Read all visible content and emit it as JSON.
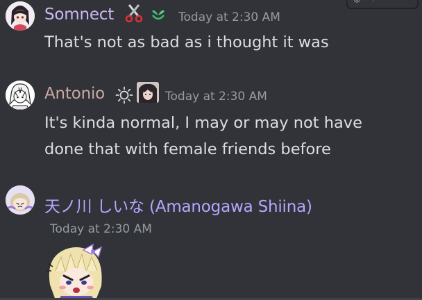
{
  "messages": [
    {
      "author": "Somnect",
      "author_color": "#c9b8f5",
      "timestamp": "Today at 2:30 AM",
      "text_lines": [
        "That's not as bad as i thought it was"
      ],
      "badges": [
        "scissors-icon",
        "sprout-icon"
      ]
    },
    {
      "author": "Antonio",
      "author_color": "#c8a8a4",
      "timestamp": "Today at 2:30 AM",
      "text_lines": [
        "It's kinda normal, I may or may not have",
        "done that with female friends before"
      ],
      "badges": [
        "sun-icon",
        "role-image-icon"
      ]
    },
    {
      "author": "天ノ川 しいな (Amanogawa Shiina)",
      "author_color": "#b4a6ff",
      "timestamp": "Today at 2:30 AM",
      "text_lines": [],
      "sticker": "chibi-sticker",
      "badges": []
    }
  ],
  "colors": {
    "background": "#313338",
    "text": "#dbdee1",
    "timestamp": "#949ba4"
  }
}
